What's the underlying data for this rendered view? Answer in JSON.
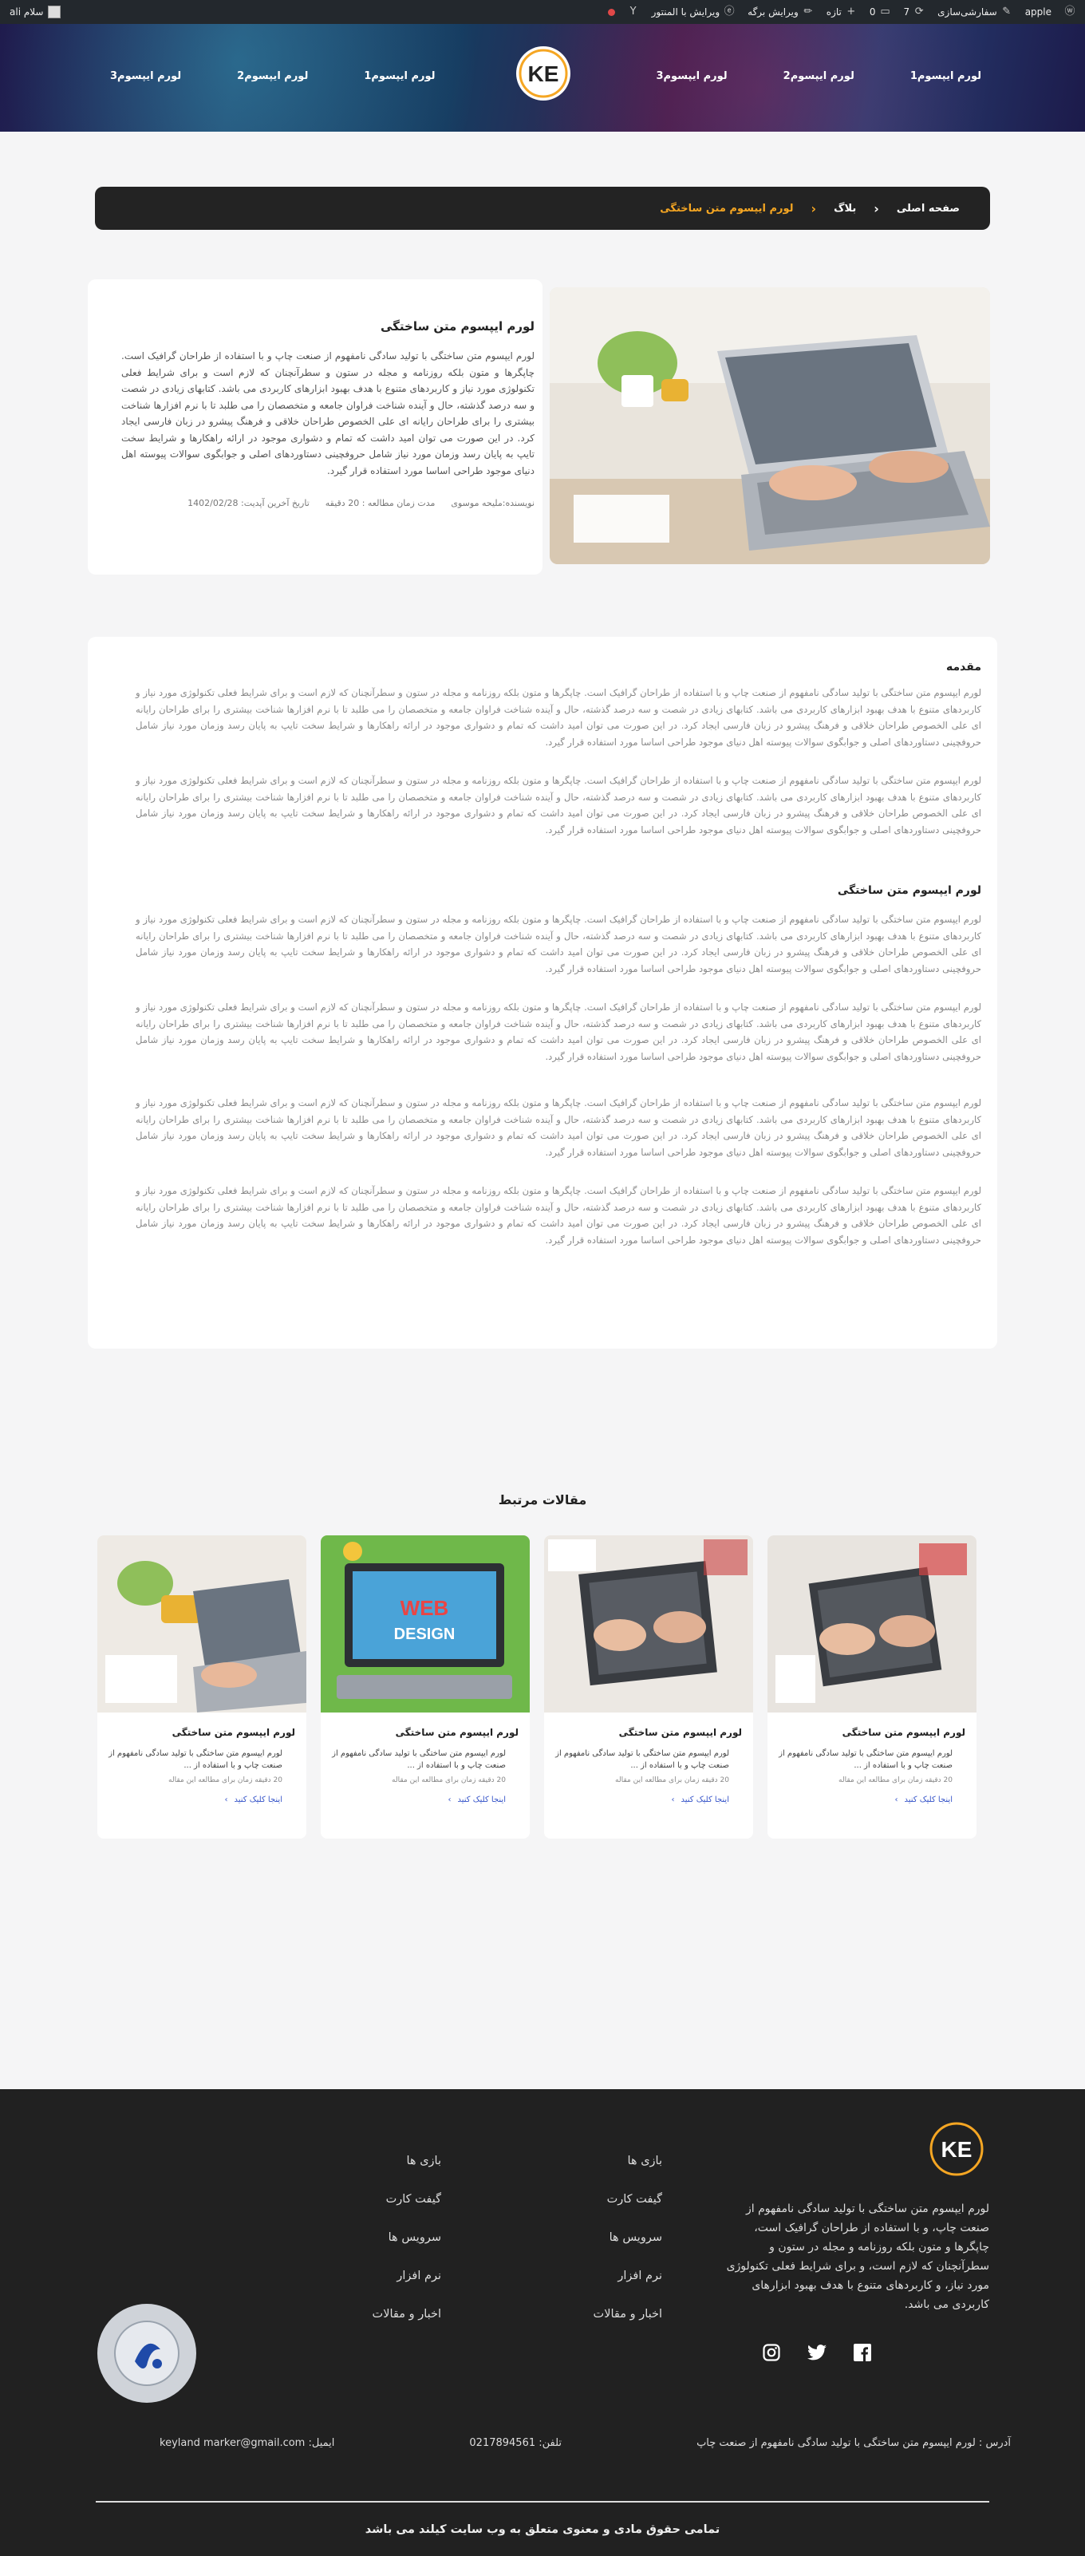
{
  "adminbar": {
    "wp_logo": "wordpress-icon",
    "site_name": "apple",
    "customize": "سفارشی‌سازی",
    "updates_count": "7",
    "comments_count": "0",
    "new_label": "تازه",
    "edit_page": "ویرایش برگه",
    "edit_elementor": "ویرایش با المنتور",
    "greeting": "سلام ali"
  },
  "header": {
    "nav_right": [
      "لورم ایپسوم1",
      "لورم ایپسوم2",
      "لورم ایپسوم3"
    ],
    "nav_left": [
      "لورم ایپسوم1",
      "لورم ایپسوم2",
      "لورم ایپسوم3"
    ],
    "logo_letters": "KE",
    "colors": {
      "accent": "#f5a623"
    }
  },
  "breadcrumb": {
    "home": "صفحه اصلی",
    "blog": "بلاگ",
    "current": "لورم ایپسوم متن ساختگی"
  },
  "hero": {
    "title": "لورم ایپسوم متن ساختگی",
    "body": "لورم ایپسوم متن ساختگی با تولید سادگی نامفهوم از صنعت چاپ و با استفاده از طراحان گرافیک است. چاپگرها و متون بلکه روزنامه و مجله در ستون و سطرآنچنان که لازم است و برای شرایط فعلی تکنولوژی مورد نیاز و کاربردهای متنوع با هدف بهبود ابزارهای کاربردی می باشد. کتابهای زیادی در شصت و سه درصد گذشته، حال و آینده شناخت فراوان جامعه و متخصصان را می طلبد تا با نرم افزارها شناخت بیشتری را برای طراحان رایانه ای علی الخصوص طراحان خلاقی و فرهنگ پیشرو در زبان فارسی ایجاد کرد. در این صورت می توان امید داشت که تمام و دشواری موجود در ارائه راهکارها و شرایط سخت تایپ به پایان رسد وزمان مورد نیاز شامل حروفچینی دستاوردهای اصلی و جوابگوی سوالات پیوسته اهل دنیای موجود طراحی اساسا مورد استفاده قرار گیرد.",
    "author": "نویسنده:ملیحه موسوی",
    "read_time": "مدت زمان مطالعه : 20 دقیقه",
    "updated": "تاریخ آخرین آپدیت: 1402/02/28"
  },
  "article": {
    "intro_heading": "مقدمه",
    "section_heading": "لورم ایپسوم متن ساختگی",
    "paragraph": "لورم ایپسوم متن ساختگی با تولید سادگی نامفهوم از صنعت چاپ و با استفاده از طراحان گرافیک است. چاپگرها و متون بلکه روزنامه و مجله در ستون و سطرآنچنان که لازم است و برای شرایط فعلی تکنولوژی مورد نیاز و کاربردهای متنوع با هدف بهبود ابزارهای کاربردی می باشد. کتابهای زیادی در شصت و سه درصد گذشته، حال و آینده شناخت فراوان جامعه و متخصصان را می طلبد تا با نرم افزارها شناخت بیشتری را برای طراحان رایانه ای علی الخصوص طراحان خلاقی و فرهنگ پیشرو در زبان فارسی ایجاد کرد. در این صورت می توان امید داشت که تمام و دشواری موجود در ارائه راهکارها و شرایط سخت تایپ به پایان رسد وزمان مورد نیاز شامل حروفچینی دستاوردهای اصلی و جوابگوی سوالات پیوسته اهل دنیای موجود طراحی اساسا مورد استفاده قرار گیرد."
  },
  "related": {
    "title": "مقالات مرتبط",
    "cards": [
      {
        "title": "لورم ایپسوم متن ساختگی",
        "excerpt": "لورم ایپسوم متن ساختگی با تولید سادگی نامفهوم از صنعت چاپ و با استفاده از ...",
        "time": "20 دقیقه زمان برای مطالعه این مقاله",
        "more": "اینجا کلیک کنید",
        "image": "laptop-typing"
      },
      {
        "title": "لورم ایپسوم متن ساختگی",
        "excerpt": "لورم ایپسوم متن ساختگی با تولید سادگی نامفهوم از صنعت چاپ و با استفاده از ...",
        "time": "20 دقیقه زمان برای مطالعه این مقاله",
        "more": "اینجا کلیک کنید",
        "image": "laptop-typing"
      },
      {
        "title": "لورم ایپسوم متن ساختگی",
        "excerpt": "لورم ایپسوم متن ساختگی با تولید سادگی نامفهوم از صنعت چاپ و با استفاده از ...",
        "time": "20 دقیقه زمان برای مطالعه این مقاله",
        "more": "اینجا کلیک کنید",
        "image": "web-design"
      },
      {
        "title": "لورم ایپسوم متن ساختگی",
        "excerpt": "لورم ایپسوم متن ساختگی با تولید سادگی نامفهوم از صنعت چاپ و با استفاده از ...",
        "time": "20 دقیقه زمان برای مطالعه این مقاله",
        "more": "اینجا کلیک کنید",
        "image": "laptop-plant"
      }
    ]
  },
  "footer": {
    "about": "لورم ایپسوم متن ساختگی با تولید سادگی نامفهوم از صنعت چاپ، و با استفاده از طراحان گرافیک است، چاپگرها و متون بلکه روزنامه و مجله در ستون و سطرآنچنان که لازم است، و برای شرایط فعلی تکنولوژی مورد نیاز، و کاربردهای متنوع با هدف بهبود ابزارهای کاربردی می باشد.",
    "links_col1": [
      "بازی ها",
      "گیفت کارت",
      "سرویس ها",
      "نرم افزار",
      "اخبار و مقالات"
    ],
    "links_col2": [
      "بازی ها",
      "گیفت کارت",
      "سرویس ها",
      "نرم افزار",
      "اخبار و مقالات"
    ],
    "address": "آدرس : لورم ایپسوم متن ساختگی با تولید سادگی نامفهوم از صنعت چاپ",
    "phone": "تلفن: 0217894561",
    "email": "ایمیل: keyland marker@gmail.com",
    "copyright": "تمامی حقوق مادی و معنوی متعلق به وب سایت کیلند می باشد",
    "socials": [
      "instagram-icon",
      "twitter-icon",
      "facebook-icon"
    ]
  }
}
